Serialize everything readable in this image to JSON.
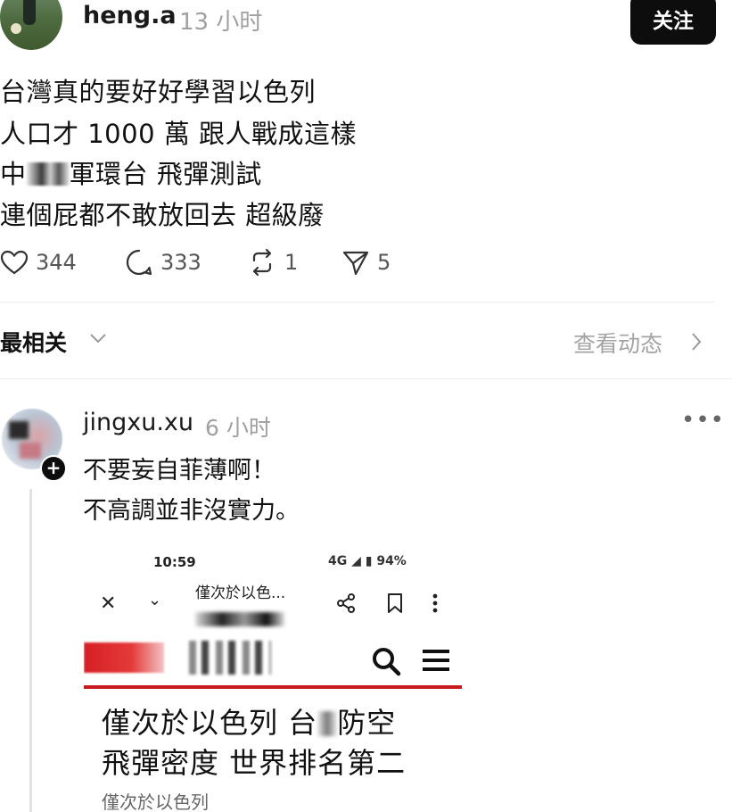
{
  "post": {
    "username": "heng.a",
    "time": "13 小时",
    "follow_label": "关注",
    "lines": [
      "台灣真的要好好學習以色列",
      "人口才 1000 萬 跟人戰成這樣",
      "軍環台 飛彈測試",
      "連個屁都不敢放回去 超級廢"
    ],
    "line3_prefix": "中",
    "counts": {
      "likes": "344",
      "replies": "333",
      "reposts": "1",
      "shares": "5"
    }
  },
  "sort": {
    "label": "最相关",
    "activity_link": "查看动态"
  },
  "reply": {
    "username": "jingxu.xu",
    "time": "6 小时",
    "more": "•••",
    "plus": "+",
    "lines": [
      "不要妄自菲薄啊！",
      "不高調並非沒實力。"
    ]
  },
  "embed": {
    "status_time": "10:59",
    "status_right": "4G ◢ ▮ 94%",
    "page_title": "僅次於以色...",
    "close_glyph": "✕",
    "down_glyph": "⌄",
    "headline_line1_a": "僅次於以色列 台",
    "headline_line1_b": "防空",
    "headline_line2": "飛彈密度 世界排名第二",
    "subtext": "僅次於以色列"
  },
  "colors": {
    "follow_bg": "#0d0d0d",
    "accent_red": "#c8191f",
    "muted": "#a0a0a0"
  },
  "icons": [
    "heart-icon",
    "reply-bubble-icon",
    "repost-icon",
    "send-icon",
    "chevron-down-icon",
    "chevron-right-icon",
    "more-icon",
    "share-icon",
    "bookmark-icon",
    "kebab-icon",
    "search-icon",
    "hamburger-icon"
  ]
}
